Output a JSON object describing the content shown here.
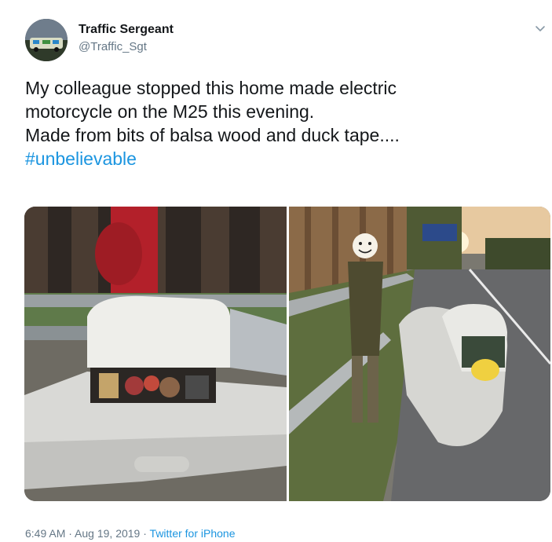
{
  "author": {
    "name": "Traffic Sergeant",
    "handle": "@Traffic_Sgt",
    "avatar_icon": "police-car-avatar"
  },
  "tweet": {
    "lines": [
      "My colleague stopped this home made electric",
      "motorcycle on the M25 this evening.",
      "Made from bits of balsa wood and duck tape...."
    ],
    "hashtag": "#unbelievable"
  },
  "media": {
    "photos": [
      {
        "subject": "close-up of white home made electric motorcycle fairing beside wooden fence"
      },
      {
        "subject": "man standing next to home made motorcycle on motorway hard shoulder"
      }
    ]
  },
  "meta": {
    "time": "6:49 AM",
    "separator": " · ",
    "date": "Aug 19, 2019",
    "source": "Twitter for iPhone"
  },
  "colors": {
    "link": "#1b95e0",
    "secondary_text": "#657786",
    "primary_text": "#14171a"
  }
}
